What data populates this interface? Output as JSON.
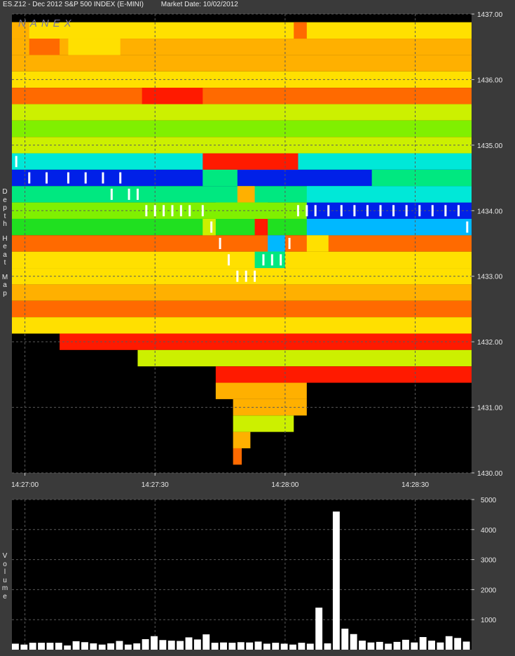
{
  "header": {
    "symbol": "ES.Z12 - Dec 2012 S&P 500 INDEX (E-MINI)",
    "market_date": "Market Date: 10/02/2012"
  },
  "watermark": "NANEX",
  "side_labels": {
    "heatmap": [
      "Depth",
      "Heat",
      "Map"
    ],
    "volume": [
      "Volume"
    ]
  },
  "colors": {
    "panel_bg": "#3a3a3a",
    "plot_bg": "#000000",
    "grid": "#5a5a5a",
    "volume_bar": "#ffffff",
    "trade_marker": "#ffffff"
  },
  "color_scale": [
    "#ff1a00",
    "#ff6a00",
    "#ffb000",
    "#ffe000",
    "#ccf000",
    "#80f000",
    "#20e020",
    "#00e880",
    "#00e8d8",
    "#00b8ff",
    "#0020e8"
  ],
  "chart_data": [
    {
      "type": "heatmap",
      "title": "Depth Heat Map",
      "x_ticks": [
        "14:27:00",
        "14:27:30",
        "14:28:00",
        "14:28:30"
      ],
      "y_ticks": [
        "1437.00",
        "1436.00",
        "1435.00",
        "1434.00",
        "1433.00",
        "1432.00",
        "1431.00",
        "1430.00"
      ],
      "xlim": [
        "14:26:57",
        "14:28:43"
      ],
      "ylim": [
        1430.0,
        1437.0
      ],
      "price_step": 0.25,
      "grid": true,
      "intensity_scale": "0 = red (low depth) to 10 = blue (high depth)",
      "segments": [
        [
          "14:26:57",
          "14:28:43",
          1436.75,
          3
        ],
        [
          "14:26:57",
          "14:28:43",
          1436.5,
          2
        ],
        [
          "14:26:57",
          "14:28:43",
          1436.25,
          2
        ],
        [
          "14:26:57",
          "14:28:43",
          1436.0,
          3
        ],
        [
          "14:26:57",
          "14:28:43",
          1435.75,
          1
        ],
        [
          "14:26:57",
          "14:28:43",
          1435.5,
          4
        ],
        [
          "14:26:57",
          "14:28:43",
          1435.25,
          5
        ],
        [
          "14:26:57",
          "14:28:43",
          1435.0,
          4
        ],
        [
          "14:26:57",
          "14:28:43",
          1434.75,
          8
        ],
        [
          "14:26:57",
          "14:28:43",
          1434.5,
          10
        ],
        [
          "14:26:57",
          "14:28:43",
          1434.25,
          7
        ],
        [
          "14:26:57",
          "14:28:43",
          1434.0,
          5
        ],
        [
          "14:26:57",
          "14:28:43",
          1433.75,
          6
        ],
        [
          "14:26:57",
          "14:28:43",
          1433.5,
          1
        ],
        [
          "14:26:57",
          "14:28:43",
          1433.25,
          3
        ],
        [
          "14:26:57",
          "14:28:43",
          1433.0,
          3
        ],
        [
          "14:26:57",
          "14:28:43",
          1432.75,
          2
        ],
        [
          "14:26:57",
          "14:28:43",
          1432.5,
          1
        ],
        [
          "14:26:57",
          "14:28:43",
          1432.25,
          3
        ],
        [
          "14:27:08",
          "14:28:43",
          1432.0,
          0
        ],
        [
          "14:27:26",
          "14:28:43",
          1431.75,
          4
        ],
        [
          "14:27:44",
          "14:28:43",
          1431.5,
          0
        ],
        [
          "14:27:44",
          "14:28:05",
          1431.25,
          2
        ],
        [
          "14:27:48",
          "14:28:05",
          1431.0,
          2
        ],
        [
          "14:27:48",
          "14:28:02",
          1430.75,
          4
        ],
        [
          "14:27:48",
          "14:27:52",
          1430.5,
          2
        ],
        [
          "14:27:48",
          "14:27:50",
          1430.25,
          1
        ],
        [
          "14:26:57",
          "14:27:01",
          1436.75,
          2
        ],
        [
          "14:27:01",
          "14:27:08",
          1436.5,
          1
        ],
        [
          "14:27:10",
          "14:27:22",
          1436.5,
          3
        ],
        [
          "14:27:27",
          "14:27:41",
          1435.75,
          0
        ],
        [
          "14:27:41",
          "14:28:03",
          1434.75,
          0
        ],
        [
          "14:27:49",
          "14:27:53",
          1434.25,
          2
        ],
        [
          "14:27:53",
          "14:27:56",
          1433.75,
          0
        ],
        [
          "14:27:56",
          "14:28:00",
          1433.5,
          9
        ],
        [
          "14:27:53",
          "14:28:00",
          1433.25,
          7
        ],
        [
          "14:27:44",
          "14:27:56",
          1434.0,
          5
        ],
        [
          "14:28:05",
          "14:28:43",
          1434.0,
          10
        ],
        [
          "14:28:05",
          "14:28:43",
          1434.25,
          8
        ],
        [
          "14:28:05",
          "14:28:43",
          1433.75,
          9
        ],
        [
          "14:28:20",
          "14:28:43",
          1434.5,
          7
        ],
        [
          "14:28:02",
          "14:28:05",
          1436.75,
          1
        ],
        [
          "14:28:05",
          "14:28:10",
          1433.5,
          3
        ],
        [
          "14:27:41",
          "14:27:44",
          1433.75,
          4
        ],
        [
          "14:27:41",
          "14:27:49",
          1434.5,
          7
        ]
      ],
      "trades": [
        [
          "14:26:58",
          1434.75
        ],
        [
          "14:27:01",
          1434.5
        ],
        [
          "14:27:05",
          1434.5
        ],
        [
          "14:27:10",
          1434.5
        ],
        [
          "14:27:14",
          1434.5
        ],
        [
          "14:27:18",
          1434.5
        ],
        [
          "14:27:20",
          1434.25
        ],
        [
          "14:27:22",
          1434.5
        ],
        [
          "14:27:24",
          1434.25
        ],
        [
          "14:27:26",
          1434.25
        ],
        [
          "14:27:28",
          1434.0
        ],
        [
          "14:27:30",
          1434.0
        ],
        [
          "14:27:32",
          1434.0
        ],
        [
          "14:27:34",
          1434.0
        ],
        [
          "14:27:36",
          1434.0
        ],
        [
          "14:27:38",
          1434.0
        ],
        [
          "14:27:41",
          1434.0
        ],
        [
          "14:27:43",
          1433.75
        ],
        [
          "14:27:45",
          1433.5
        ],
        [
          "14:27:47",
          1433.25
        ],
        [
          "14:27:49",
          1433.0
        ],
        [
          "14:27:51",
          1433.0
        ],
        [
          "14:27:53",
          1433.0
        ],
        [
          "14:27:55",
          1433.25
        ],
        [
          "14:27:57",
          1433.25
        ],
        [
          "14:27:59",
          1433.25
        ],
        [
          "14:28:01",
          1433.5
        ],
        [
          "14:28:03",
          1434.0
        ],
        [
          "14:28:05",
          1434.0
        ],
        [
          "14:28:07",
          1434.0
        ],
        [
          "14:28:10",
          1434.0
        ],
        [
          "14:28:13",
          1434.0
        ],
        [
          "14:28:16",
          1434.0
        ],
        [
          "14:28:19",
          1434.0
        ],
        [
          "14:28:22",
          1434.0
        ],
        [
          "14:28:25",
          1434.0
        ],
        [
          "14:28:28",
          1434.0
        ],
        [
          "14:28:31",
          1434.0
        ],
        [
          "14:28:34",
          1434.0
        ],
        [
          "14:28:37",
          1434.0
        ],
        [
          "14:28:40",
          1434.0
        ],
        [
          "14:28:42",
          1433.75
        ]
      ]
    },
    {
      "type": "bar",
      "title": "Volume",
      "y_ticks": [
        "1000",
        "2000",
        "3000",
        "4000",
        "5000"
      ],
      "ylim": [
        0,
        5000
      ],
      "xlim": [
        "14:26:57",
        "14:28:43"
      ],
      "grid": true,
      "bars": [
        [
          "14:26:57",
          200
        ],
        [
          "14:26:59",
          170
        ],
        [
          "14:27:01",
          230
        ],
        [
          "14:27:03",
          230
        ],
        [
          "14:27:05",
          230
        ],
        [
          "14:27:07",
          230
        ],
        [
          "14:27:09",
          140
        ],
        [
          "14:27:11",
          280
        ],
        [
          "14:27:13",
          250
        ],
        [
          "14:27:15",
          210
        ],
        [
          "14:27:17",
          170
        ],
        [
          "14:27:19",
          210
        ],
        [
          "14:27:21",
          290
        ],
        [
          "14:27:23",
          170
        ],
        [
          "14:27:25",
          210
        ],
        [
          "14:27:27",
          350
        ],
        [
          "14:27:29",
          450
        ],
        [
          "14:27:31",
          320
        ],
        [
          "14:27:33",
          300
        ],
        [
          "14:27:35",
          290
        ],
        [
          "14:27:37",
          410
        ],
        [
          "14:27:39",
          340
        ],
        [
          "14:27:41",
          510
        ],
        [
          "14:27:43",
          230
        ],
        [
          "14:27:45",
          240
        ],
        [
          "14:27:47",
          230
        ],
        [
          "14:27:49",
          250
        ],
        [
          "14:27:51",
          240
        ],
        [
          "14:27:53",
          270
        ],
        [
          "14:27:55",
          200
        ],
        [
          "14:27:57",
          230
        ],
        [
          "14:27:59",
          200
        ],
        [
          "14:28:01",
          170
        ],
        [
          "14:28:03",
          230
        ],
        [
          "14:28:05",
          200
        ],
        [
          "14:28:07",
          1400
        ],
        [
          "14:28:09",
          210
        ],
        [
          "14:28:11",
          4600
        ],
        [
          "14:28:13",
          700
        ],
        [
          "14:28:15",
          520
        ],
        [
          "14:28:17",
          300
        ],
        [
          "14:28:19",
          240
        ],
        [
          "14:28:21",
          260
        ],
        [
          "14:28:23",
          200
        ],
        [
          "14:28:25",
          260
        ],
        [
          "14:28:27",
          330
        ],
        [
          "14:28:29",
          240
        ],
        [
          "14:28:31",
          420
        ],
        [
          "14:28:33",
          300
        ],
        [
          "14:28:35",
          240
        ],
        [
          "14:28:37",
          450
        ],
        [
          "14:28:39",
          390
        ],
        [
          "14:28:41",
          270
        ]
      ]
    }
  ]
}
